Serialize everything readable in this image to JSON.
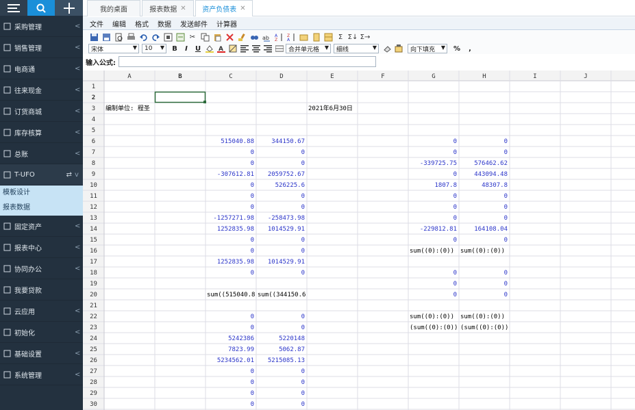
{
  "sidebar": {
    "items": [
      {
        "label": "采购管理",
        "icon": "cart-icon",
        "arrow": "<"
      },
      {
        "label": "销售管理",
        "icon": "chart-icon",
        "arrow": "<"
      },
      {
        "label": "电商通",
        "icon": "store-icon",
        "arrow": "<"
      },
      {
        "label": "往来现金",
        "icon": "cash-icon",
        "arrow": "<"
      },
      {
        "label": "订货商城",
        "icon": "order-icon",
        "arrow": "<"
      },
      {
        "label": "库存核算",
        "icon": "warehouse-icon",
        "arrow": "<"
      },
      {
        "label": "总账",
        "icon": "ledger-icon",
        "arrow": "<"
      },
      {
        "label": "T-UFO",
        "icon": "report-icon",
        "arrow": "v",
        "active": true
      }
    ],
    "submenu": [
      "模板设计",
      "报表数据"
    ],
    "items2": [
      {
        "label": "固定资产",
        "icon": "asset-icon",
        "arrow": "<"
      },
      {
        "label": "报表中心",
        "icon": "report-center-icon",
        "arrow": "<"
      },
      {
        "label": "协同办公",
        "icon": "collab-icon",
        "arrow": "<"
      },
      {
        "label": "我要贷款",
        "icon": "loan-icon",
        "arrow": ""
      },
      {
        "label": "云应用",
        "icon": "cloud-icon",
        "arrow": "<"
      },
      {
        "label": "初始化",
        "icon": "init-icon",
        "arrow": "<"
      },
      {
        "label": "基础设置",
        "icon": "settings-icon",
        "arrow": "<"
      },
      {
        "label": "系统管理",
        "icon": "system-icon",
        "arrow": "<"
      }
    ]
  },
  "tabs": [
    {
      "label": "我的桌面",
      "closable": false,
      "active": false
    },
    {
      "label": "报表数据",
      "closable": true,
      "active": false
    },
    {
      "label": "资产负债表",
      "closable": true,
      "active": true
    }
  ],
  "menubar": [
    "文件",
    "编辑",
    "格式",
    "数据",
    "发送邮件",
    "计算器"
  ],
  "toolbar2": {
    "font": "宋体",
    "size": "10",
    "merge": "合并单元格",
    "border": "细线",
    "fill": "向下填充",
    "percent": "%",
    "comma": ","
  },
  "formula": {
    "label": "输入公式:",
    "value": ""
  },
  "grid": {
    "columns": [
      "A",
      "B",
      "C",
      "D",
      "E",
      "F",
      "G",
      "H",
      "I",
      "J"
    ],
    "rows": [
      "1",
      "2",
      "3",
      "4",
      "5",
      "6",
      "7",
      "8",
      "9",
      "10",
      "11",
      "12",
      "13",
      "14",
      "15",
      "16",
      "17",
      "18",
      "19",
      "20",
      "21",
      "22",
      "23",
      "24",
      "25",
      "26",
      "27",
      "28",
      "29",
      "30"
    ],
    "cells": [
      {
        "r": 3,
        "c": 0,
        "text": "编制单位: 程圣",
        "align": "left",
        "color": "#000"
      },
      {
        "r": 3,
        "c": 4,
        "text": "2021年6月30日",
        "align": "left",
        "color": "#000"
      },
      {
        "r": 6,
        "c": 2,
        "text": "515040.88",
        "align": "right",
        "color": "#2a34c9"
      },
      {
        "r": 6,
        "c": 3,
        "text": "344150.67",
        "align": "right",
        "color": "#2a34c9"
      },
      {
        "r": 6,
        "c": 6,
        "text": "0",
        "align": "right",
        "color": "#2a34c9"
      },
      {
        "r": 6,
        "c": 7,
        "text": "0",
        "align": "right",
        "color": "#2a34c9"
      },
      {
        "r": 7,
        "c": 2,
        "text": "0",
        "align": "right",
        "color": "#2a34c9"
      },
      {
        "r": 7,
        "c": 3,
        "text": "0",
        "align": "right",
        "color": "#2a34c9"
      },
      {
        "r": 7,
        "c": 6,
        "text": "0",
        "align": "right",
        "color": "#2a34c9"
      },
      {
        "r": 7,
        "c": 7,
        "text": "0",
        "align": "right",
        "color": "#2a34c9"
      },
      {
        "r": 8,
        "c": 2,
        "text": "0",
        "align": "right",
        "color": "#2a34c9"
      },
      {
        "r": 8,
        "c": 3,
        "text": "0",
        "align": "right",
        "color": "#2a34c9"
      },
      {
        "r": 8,
        "c": 6,
        "text": "-339725.75",
        "align": "right",
        "color": "#2a34c9"
      },
      {
        "r": 8,
        "c": 7,
        "text": "576462.62",
        "align": "right",
        "color": "#2a34c9"
      },
      {
        "r": 9,
        "c": 2,
        "text": "-307612.81",
        "align": "right",
        "color": "#2a34c9"
      },
      {
        "r": 9,
        "c": 3,
        "text": "2059752.67",
        "align": "right",
        "color": "#2a34c9"
      },
      {
        "r": 9,
        "c": 6,
        "text": "0",
        "align": "right",
        "color": "#2a34c9"
      },
      {
        "r": 9,
        "c": 7,
        "text": "443094.48",
        "align": "right",
        "color": "#2a34c9"
      },
      {
        "r": 10,
        "c": 2,
        "text": "0",
        "align": "right",
        "color": "#2a34c9"
      },
      {
        "r": 10,
        "c": 3,
        "text": "526225.6",
        "align": "right",
        "color": "#2a34c9"
      },
      {
        "r": 10,
        "c": 6,
        "text": "1807.8",
        "align": "right",
        "color": "#2a34c9"
      },
      {
        "r": 10,
        "c": 7,
        "text": "48307.8",
        "align": "right",
        "color": "#2a34c9"
      },
      {
        "r": 11,
        "c": 2,
        "text": "0",
        "align": "right",
        "color": "#2a34c9"
      },
      {
        "r": 11,
        "c": 3,
        "text": "0",
        "align": "right",
        "color": "#2a34c9"
      },
      {
        "r": 11,
        "c": 6,
        "text": "0",
        "align": "right",
        "color": "#2a34c9"
      },
      {
        "r": 11,
        "c": 7,
        "text": "0",
        "align": "right",
        "color": "#2a34c9"
      },
      {
        "r": 12,
        "c": 2,
        "text": "0",
        "align": "right",
        "color": "#2a34c9"
      },
      {
        "r": 12,
        "c": 3,
        "text": "0",
        "align": "right",
        "color": "#2a34c9"
      },
      {
        "r": 12,
        "c": 6,
        "text": "0",
        "align": "right",
        "color": "#2a34c9"
      },
      {
        "r": 12,
        "c": 7,
        "text": "0",
        "align": "right",
        "color": "#2a34c9"
      },
      {
        "r": 13,
        "c": 2,
        "text": "-1257271.98",
        "align": "right",
        "color": "#2a34c9"
      },
      {
        "r": 13,
        "c": 3,
        "text": "-258473.98",
        "align": "right",
        "color": "#2a34c9"
      },
      {
        "r": 13,
        "c": 6,
        "text": "0",
        "align": "right",
        "color": "#2a34c9"
      },
      {
        "r": 13,
        "c": 7,
        "text": "0",
        "align": "right",
        "color": "#2a34c9"
      },
      {
        "r": 14,
        "c": 2,
        "text": "1252835.98",
        "align": "right",
        "color": "#2a34c9"
      },
      {
        "r": 14,
        "c": 3,
        "text": "1014529.91",
        "align": "right",
        "color": "#2a34c9"
      },
      {
        "r": 14,
        "c": 6,
        "text": "-229812.81",
        "align": "right",
        "color": "#2a34c9"
      },
      {
        "r": 14,
        "c": 7,
        "text": "164108.04",
        "align": "right",
        "color": "#2a34c9"
      },
      {
        "r": 15,
        "c": 2,
        "text": "0",
        "align": "right",
        "color": "#2a34c9"
      },
      {
        "r": 15,
        "c": 3,
        "text": "0",
        "align": "right",
        "color": "#2a34c9"
      },
      {
        "r": 15,
        "c": 6,
        "text": "0",
        "align": "right",
        "color": "#2a34c9"
      },
      {
        "r": 15,
        "c": 7,
        "text": "0",
        "align": "right",
        "color": "#2a34c9"
      },
      {
        "r": 16,
        "c": 2,
        "text": "0",
        "align": "right",
        "color": "#2a34c9"
      },
      {
        "r": 16,
        "c": 3,
        "text": "0",
        "align": "right",
        "color": "#2a34c9"
      },
      {
        "r": 16,
        "c": 6,
        "text": "sum((0):(0))",
        "align": "left",
        "color": "#000"
      },
      {
        "r": 16,
        "c": 7,
        "text": "sum((0):(0))",
        "align": "left",
        "color": "#000"
      },
      {
        "r": 17,
        "c": 2,
        "text": "1252835.98",
        "align": "right",
        "color": "#2a34c9"
      },
      {
        "r": 17,
        "c": 3,
        "text": "1014529.91",
        "align": "right",
        "color": "#2a34c9"
      },
      {
        "r": 18,
        "c": 2,
        "text": "0",
        "align": "right",
        "color": "#2a34c9"
      },
      {
        "r": 18,
        "c": 3,
        "text": "0",
        "align": "right",
        "color": "#2a34c9"
      },
      {
        "r": 18,
        "c": 6,
        "text": "0",
        "align": "right",
        "color": "#2a34c9"
      },
      {
        "r": 18,
        "c": 7,
        "text": "0",
        "align": "right",
        "color": "#2a34c9"
      },
      {
        "r": 19,
        "c": 6,
        "text": "0",
        "align": "right",
        "color": "#2a34c9"
      },
      {
        "r": 19,
        "c": 7,
        "text": "0",
        "align": "right",
        "color": "#2a34c9"
      },
      {
        "r": 20,
        "c": 2,
        "text": "sum((515040.8",
        "align": "left",
        "color": "#000"
      },
      {
        "r": 20,
        "c": 3,
        "text": "sum((344150.6",
        "align": "left",
        "color": "#000"
      },
      {
        "r": 20,
        "c": 6,
        "text": "0",
        "align": "right",
        "color": "#2a34c9"
      },
      {
        "r": 20,
        "c": 7,
        "text": "0",
        "align": "right",
        "color": "#2a34c9"
      },
      {
        "r": 22,
        "c": 2,
        "text": "0",
        "align": "right",
        "color": "#2a34c9"
      },
      {
        "r": 22,
        "c": 3,
        "text": "0",
        "align": "right",
        "color": "#2a34c9"
      },
      {
        "r": 22,
        "c": 6,
        "text": "sum((0):(0))",
        "align": "left",
        "color": "#000"
      },
      {
        "r": 22,
        "c": 7,
        "text": "sum((0):(0))",
        "align": "left",
        "color": "#000"
      },
      {
        "r": 23,
        "c": 2,
        "text": "0",
        "align": "right",
        "color": "#2a34c9"
      },
      {
        "r": 23,
        "c": 3,
        "text": "0",
        "align": "right",
        "color": "#2a34c9"
      },
      {
        "r": 23,
        "c": 6,
        "text": "(sum((0):(0)))",
        "align": "left",
        "color": "#000"
      },
      {
        "r": 23,
        "c": 7,
        "text": "(sum((0):(0)))",
        "align": "left",
        "color": "#000"
      },
      {
        "r": 24,
        "c": 2,
        "text": "5242386",
        "align": "right",
        "color": "#2a34c9"
      },
      {
        "r": 24,
        "c": 3,
        "text": "5220148",
        "align": "right",
        "color": "#2a34c9"
      },
      {
        "r": 25,
        "c": 2,
        "text": "7823.99",
        "align": "right",
        "color": "#2a34c9"
      },
      {
        "r": 25,
        "c": 3,
        "text": "5062.87",
        "align": "right",
        "color": "#2a34c9"
      },
      {
        "r": 26,
        "c": 2,
        "text": "5234562.01",
        "align": "right",
        "color": "#2a34c9"
      },
      {
        "r": 26,
        "c": 3,
        "text": "5215085.13",
        "align": "right",
        "color": "#2a34c9"
      },
      {
        "r": 27,
        "c": 2,
        "text": "0",
        "align": "right",
        "color": "#2a34c9"
      },
      {
        "r": 27,
        "c": 3,
        "text": "0",
        "align": "right",
        "color": "#2a34c9"
      },
      {
        "r": 28,
        "c": 2,
        "text": "0",
        "align": "right",
        "color": "#2a34c9"
      },
      {
        "r": 28,
        "c": 3,
        "text": "0",
        "align": "right",
        "color": "#2a34c9"
      },
      {
        "r": 29,
        "c": 2,
        "text": "0",
        "align": "right",
        "color": "#2a34c9"
      },
      {
        "r": 29,
        "c": 3,
        "text": "0",
        "align": "right",
        "color": "#2a34c9"
      },
      {
        "r": 30,
        "c": 2,
        "text": "0",
        "align": "right",
        "color": "#2a34c9"
      },
      {
        "r": 30,
        "c": 3,
        "text": "0",
        "align": "right",
        "color": "#2a34c9"
      }
    ],
    "selected_cell": {
      "r": 2,
      "c": 1
    }
  },
  "colors": {
    "sidebar_bg": "#23313f",
    "accent": "#1a8fd9",
    "value_blue": "#2a34c9",
    "selection": "#2d6b3b"
  }
}
